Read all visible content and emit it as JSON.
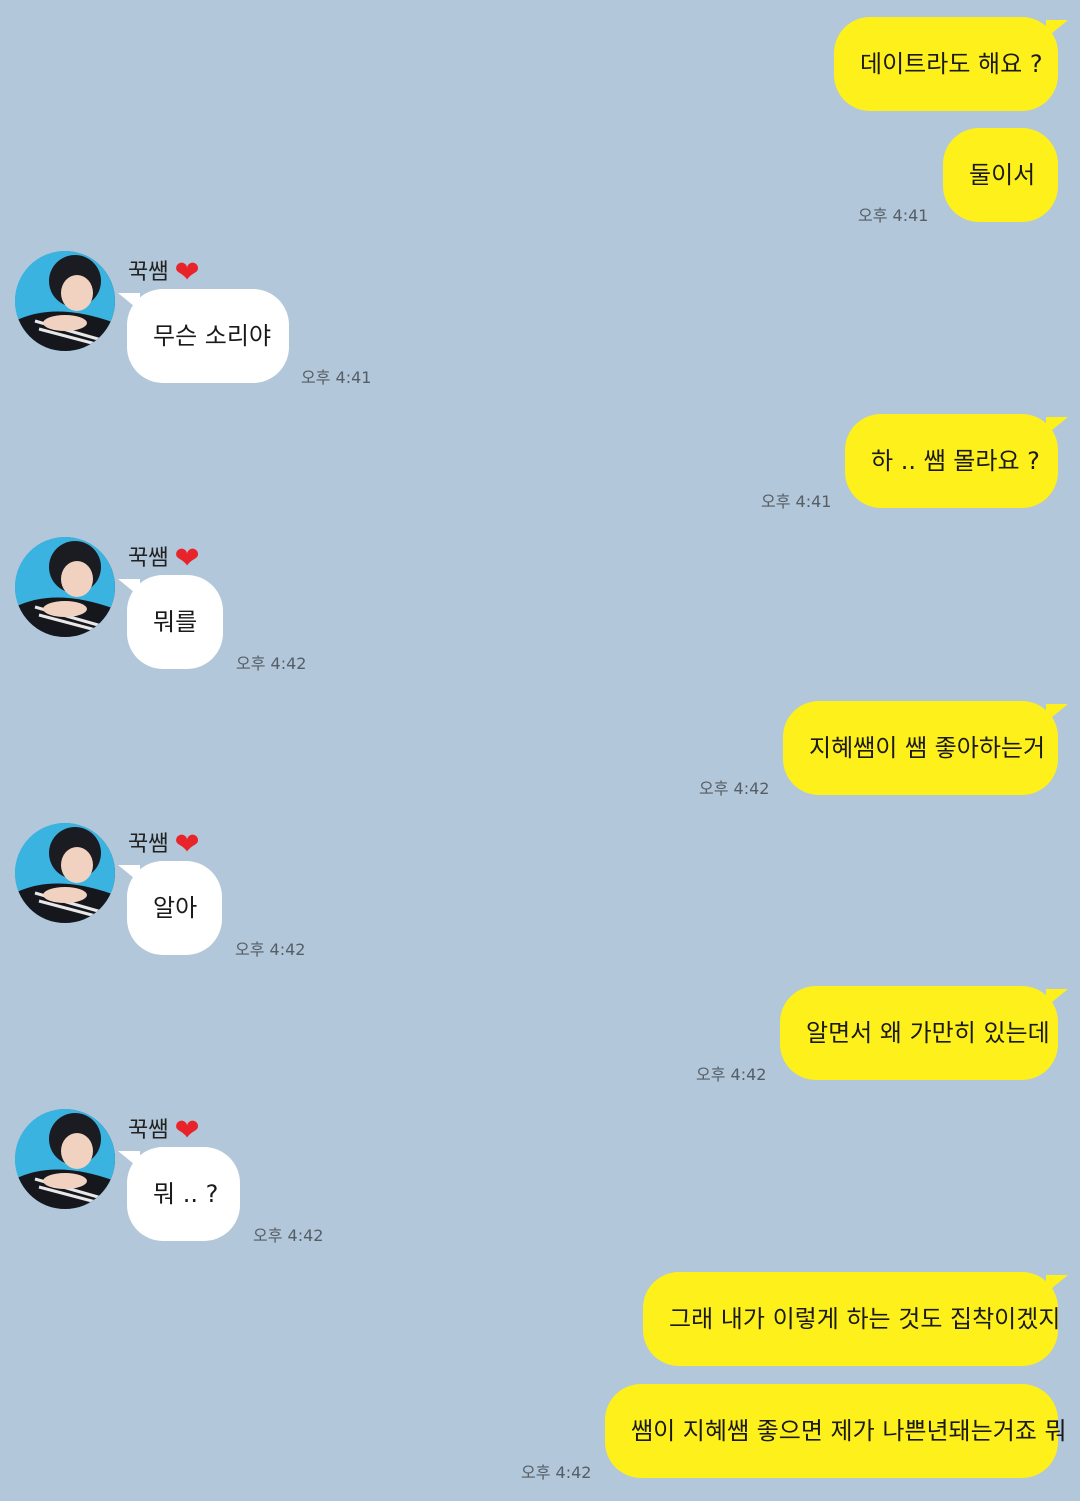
{
  "contact": {
    "name": "꾹쌤",
    "heart_icon": "heart-icon",
    "heart_color": "#e8232a"
  },
  "colors": {
    "background": "#b2c7d9",
    "my_bubble": "#fef01b",
    "their_bubble": "#ffffff"
  },
  "messages": [
    {
      "from": "me",
      "text": "데이트라도 해요 ?"
    },
    {
      "from": "me",
      "text": "둘이서",
      "time": "오후 4:41"
    },
    {
      "from": "other",
      "text": "무슨 소리야",
      "time": "오후 4:41"
    },
    {
      "from": "me",
      "text": "하 .. 쌤 몰라요 ?",
      "time": "오후 4:41"
    },
    {
      "from": "other",
      "text": "뭐를",
      "time": "오후 4:42"
    },
    {
      "from": "me",
      "text": "지혜쌤이 쌤 좋아하는거",
      "time": "오후 4:42"
    },
    {
      "from": "other",
      "text": "알아",
      "time": "오후 4:42"
    },
    {
      "from": "me",
      "text": "알면서 왜 가만히 있는데",
      "time": "오후 4:42"
    },
    {
      "from": "other",
      "text": "뭐 .. ?",
      "time": "오후 4:42"
    },
    {
      "from": "me",
      "text": "그래 내가 이렇게 하는 것도 집착이겠지"
    },
    {
      "from": "me",
      "text": "쌤이 지혜쌤 좋으면 제가 나쁜년돼는거죠 뭐",
      "time": "오후 4:42"
    }
  ]
}
